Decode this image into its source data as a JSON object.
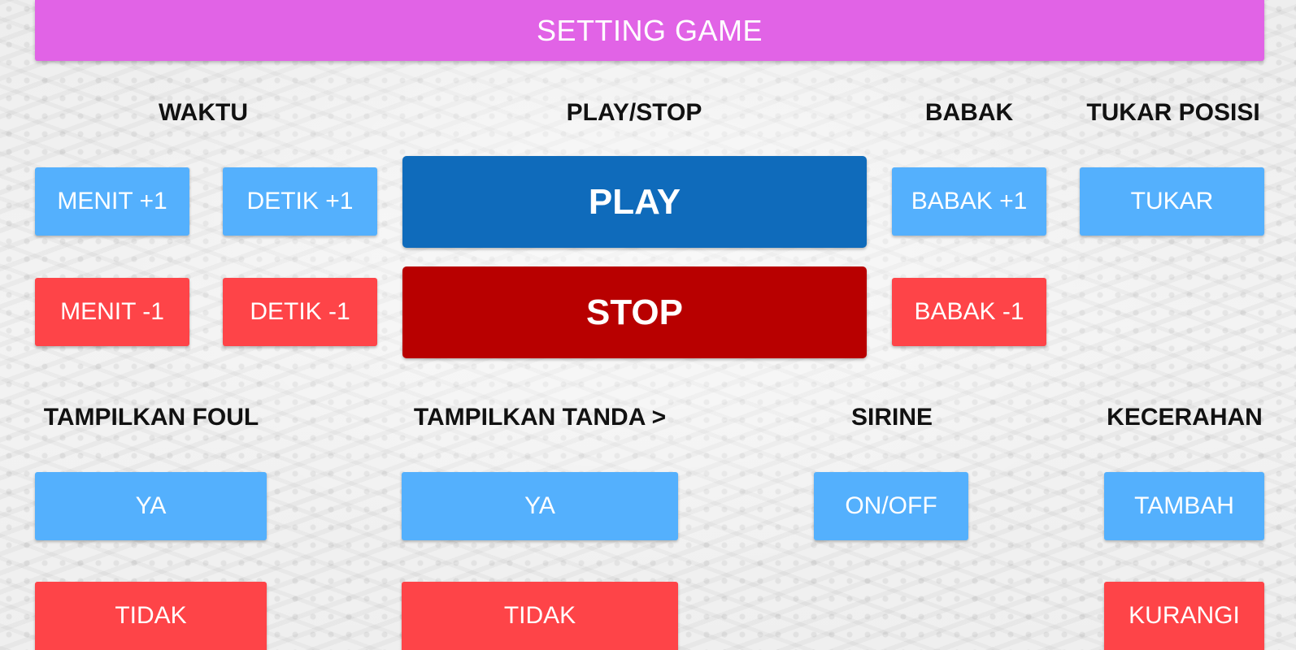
{
  "header": {
    "title": "SETTING GAME"
  },
  "sections": {
    "waktu": "WAKTU",
    "play_stop": "PLAY/STOP",
    "babak": "BABAK",
    "tukar_posisi": "TUKAR POSISI",
    "tampilkan_foul": "TAMPILKAN FOUL",
    "tampilkan_tanda": "TAMPILKAN TANDA >",
    "sirine": "SIRINE",
    "kecerahan": "KECERAHAN"
  },
  "buttons": {
    "menit_plus": "MENIT +1",
    "detik_plus": "DETIK +1",
    "menit_minus": "MENIT -1",
    "detik_minus": "DETIK -1",
    "play": "PLAY",
    "stop": "STOP",
    "babak_plus": "BABAK +1",
    "babak_minus": "BABAK -1",
    "tukar": "TUKAR",
    "foul_ya": "YA",
    "foul_tidak": "TIDAK",
    "tanda_ya": "YA",
    "tanda_tidak": "TIDAK",
    "sirine_toggle": "ON/OFF",
    "kecerahan_tambah": "TAMBAH",
    "kecerahan_kurangi": "KURANGI"
  },
  "colors": {
    "header": "#e163e6",
    "button_positive": "#54b0fd",
    "button_negative": "#fe4448",
    "play": "#0f6bbb",
    "stop": "#b80000"
  }
}
